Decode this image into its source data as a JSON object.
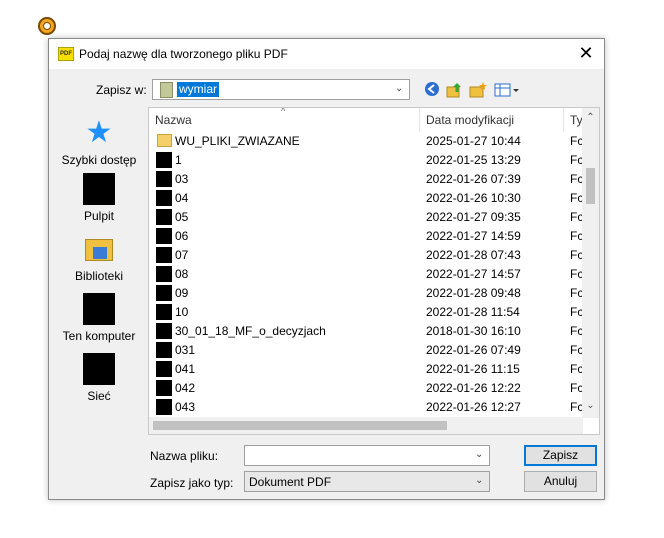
{
  "dialog": {
    "title": "Podaj nazwę dla tworzonego pliku PDF",
    "app_icon_text": "PDF",
    "close_glyph": "✕"
  },
  "save_in": {
    "label": "Zapisz w:",
    "value": "wymiar"
  },
  "toolbar": {
    "icons": [
      "back-icon",
      "up-folder-icon",
      "new-folder-icon",
      "view-menu-icon"
    ]
  },
  "places": [
    {
      "label": "Szybki dostęp",
      "icon": "star-icon"
    },
    {
      "label": "Pulpit",
      "icon": "desktop-icon"
    },
    {
      "label": "Biblioteki",
      "icon": "libraries-icon"
    },
    {
      "label": "Ten komputer",
      "icon": "computer-icon"
    },
    {
      "label": "Sieć",
      "icon": "network-icon"
    }
  ],
  "columns": {
    "name": "Nazwa",
    "date": "Data modyfikacji",
    "type": "Ty"
  },
  "files": [
    {
      "name": "WU_PLIKI_ZWIAZANE",
      "date": "2025-01-27 10:44",
      "type": "Fc",
      "folder": true
    },
    {
      "name": "1",
      "date": "2022-01-25 13:29",
      "type": "Fc"
    },
    {
      "name": "03",
      "date": "2022-01-26 07:39",
      "type": "Fc"
    },
    {
      "name": "04",
      "date": "2022-01-26 10:30",
      "type": "Fc"
    },
    {
      "name": "05",
      "date": "2022-01-27 09:35",
      "type": "Fc"
    },
    {
      "name": "06",
      "date": "2022-01-27 14:59",
      "type": "Fc"
    },
    {
      "name": "07",
      "date": "2022-01-28 07:43",
      "type": "Fc"
    },
    {
      "name": "08",
      "date": "2022-01-27 14:57",
      "type": "Fc"
    },
    {
      "name": "09",
      "date": "2022-01-28 09:48",
      "type": "Fc"
    },
    {
      "name": "10",
      "date": "2022-01-28 11:54",
      "type": "Fc"
    },
    {
      "name": "30_01_18_MF_o_decyzjach",
      "date": "2018-01-30 16:10",
      "type": "Fc"
    },
    {
      "name": "031",
      "date": "2022-01-26 07:49",
      "type": "Fc"
    },
    {
      "name": "041",
      "date": "2022-01-26 11:15",
      "type": "Fc"
    },
    {
      "name": "042",
      "date": "2022-01-26 12:22",
      "type": "Fc"
    },
    {
      "name": "043",
      "date": "2022-01-26 12:27",
      "type": "Fc"
    }
  ],
  "filename": {
    "label": "Nazwa pliku:",
    "value": ""
  },
  "filetype": {
    "label": "Zapisz jako typ:",
    "value": "Dokument PDF"
  },
  "buttons": {
    "save": "Zapisz",
    "cancel": "Anuluj"
  }
}
